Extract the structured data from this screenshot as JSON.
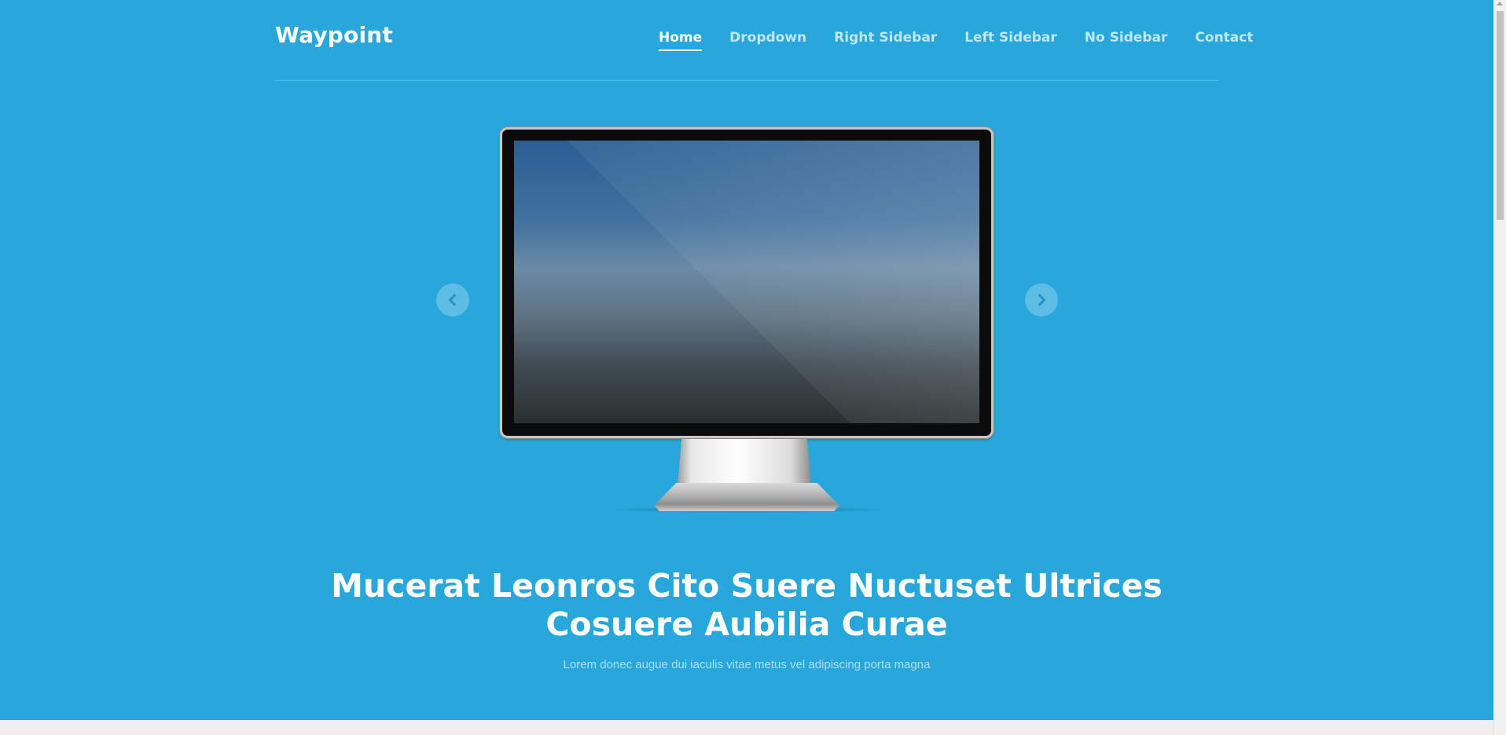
{
  "header": {
    "logo": "Waypoint",
    "nav": [
      {
        "label": "Home",
        "active": true
      },
      {
        "label": "Dropdown",
        "active": false
      },
      {
        "label": "Right Sidebar",
        "active": false
      },
      {
        "label": "Left Sidebar",
        "active": false
      },
      {
        "label": "No Sidebar",
        "active": false
      },
      {
        "label": "Contact",
        "active": false
      }
    ]
  },
  "carousel": {
    "prev_icon": "chevron-left-icon",
    "next_icon": "chevron-right-icon"
  },
  "hero": {
    "title_line1": "Mucerat Leonros Cito Suere Nuctuset Ultrices",
    "title_line2": "Cosuere Aubilia Curae",
    "subtitle": "Lorem donec augue dui iaculis vitae metus vel adipiscing porta magna"
  },
  "colors": {
    "background": "#27a7db",
    "text": "#ffffff",
    "page_bottom": "#efefef"
  }
}
